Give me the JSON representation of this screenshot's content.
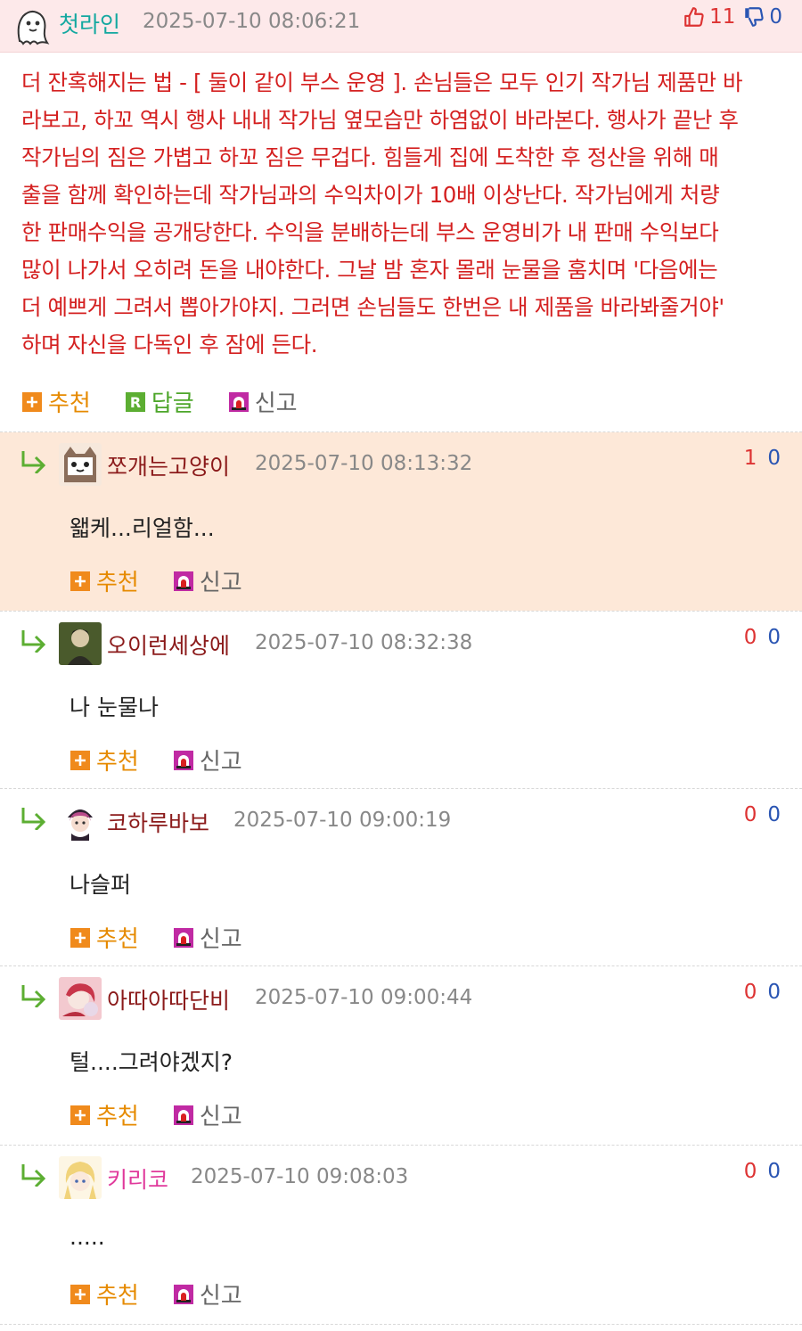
{
  "post": {
    "author": "첫라인",
    "timestamp": "2025-07-10 08:06:21",
    "upvotes": "11",
    "downvotes": "0",
    "body_lines": [
      "더 잔혹해지는 법 - [ 둘이 같이 부스 운영 ]. 손님들은 모두 인기 작가님 제품만 바",
      "라보고, 하꼬 역시 행사 내내 작가님 옆모습만 하염없이 바라본다. 행사가 끝난 후",
      "작가님의 짐은 가볍고 하꼬 짐은 무겁다. 힘들게 집에 도착한 후 정산을 위해 매",
      "출을 함께 확인하는데 작가님과의 수익차이가 10배 이상난다. 작가님에게 처량",
      "한 판매수익을 공개당한다. 수익을 분배하는데 부스 운영비가 내 판매 수익보다",
      "많이 나가서 오히려 돈을 내야한다. 그날 밤 혼자 몰래 눈물을 훔치며 '다음에는",
      "더 예쁘게 그려서 뽑아가야지. 그러면 손님들도 한번은 내 제품을 바라봐줄거야'",
      "하며 자신을 다독인 후 잠에 든다."
    ],
    "actions": {
      "recommend": "추천",
      "reply": "답글",
      "report": "신고"
    }
  },
  "comment_actions": {
    "recommend": "추천",
    "report": "신고"
  },
  "comments": [
    {
      "author": "쪼개는고양이",
      "timestamp": "2025-07-10 08:13:32",
      "text": "왧케...리얼함...",
      "up": "1",
      "down": "0"
    },
    {
      "author": "오이런세상에",
      "timestamp": "2025-07-10 08:32:38",
      "text": "나 눈물나",
      "up": "0",
      "down": "0"
    },
    {
      "author": "코하루바보",
      "timestamp": "2025-07-10 09:00:19",
      "text": "나슬퍼",
      "up": "0",
      "down": "0"
    },
    {
      "author": "아따아따단비",
      "timestamp": "2025-07-10 09:00:44",
      "text": "털....그려야겠지?",
      "up": "0",
      "down": "0"
    },
    {
      "author": "키리코",
      "timestamp": "2025-07-10 09:08:03",
      "text": ".....",
      "up": "0",
      "down": "0"
    }
  ],
  "colors": {
    "header_bg": "#fde9ea",
    "post_text": "#d42020",
    "highlight_bg": "#fde8d8",
    "author_name": "#8b1a1a",
    "upvote": "#dd3333",
    "downvote": "#2a55b3",
    "recommend_icon": "#f08a1c",
    "reply_icon": "#5cae32",
    "report_icon": "#c02aa3"
  },
  "icons": [
    "ghost-avatar-icon",
    "thumbs-up-icon",
    "thumbs-down-icon",
    "plus-icon",
    "reply-r-icon",
    "siren-icon",
    "reply-arrow-icon"
  ]
}
